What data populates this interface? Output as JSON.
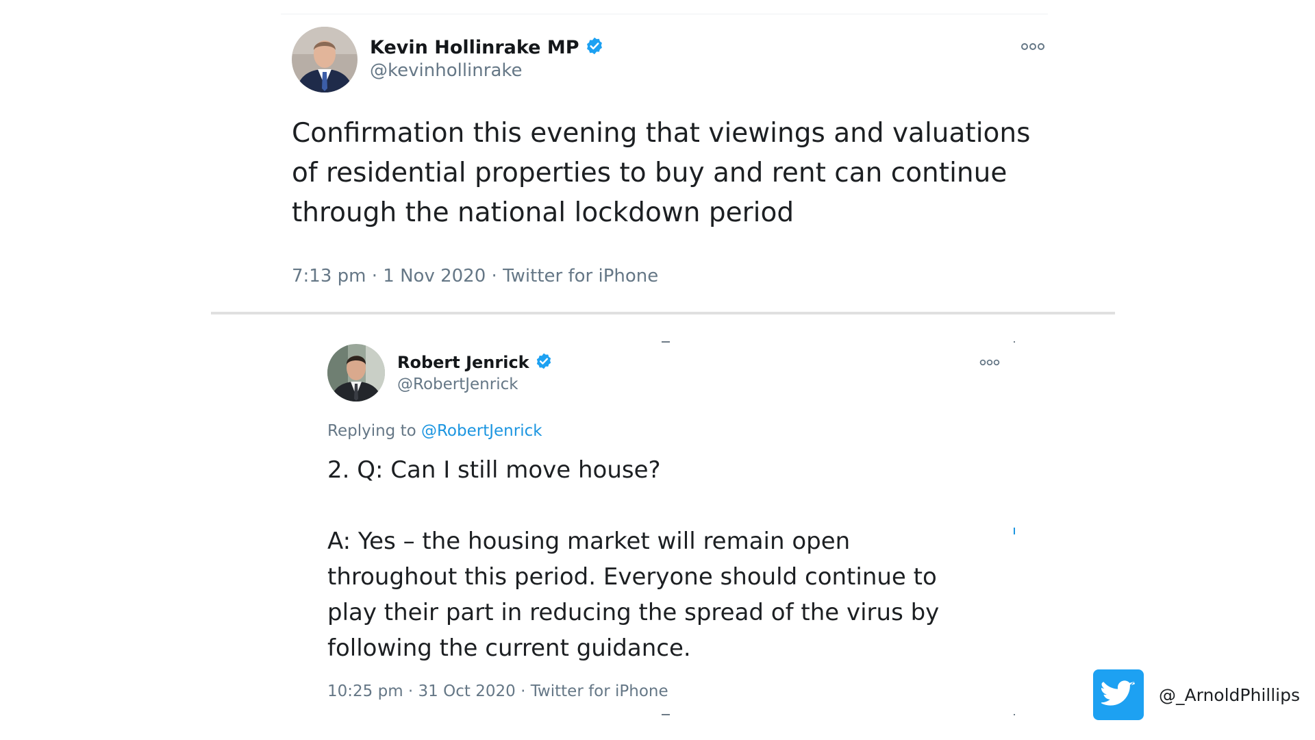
{
  "tweet1": {
    "display_name": "Kevin Hollinrake MP",
    "handle": "@kevinhollinrake",
    "text": "Confirmation this evening that viewings and valuations of residential properties to buy and rent can continue through the national lockdown period",
    "time": "7:13 pm",
    "date": "1 Nov 2020",
    "source": "Twitter for iPhone",
    "verified": true
  },
  "tweet2": {
    "display_name": "Robert Jenrick",
    "handle": "@RobertJenrick",
    "replying_to_prefix": "Replying to",
    "replying_to_handle": "@RobertJenrick",
    "text_question": "2. Q: Can I still move house?",
    "text_answer": "A: Yes – the housing market will remain open throughout this period. Everyone should continue to play their part in reducing the spread of the virus by following the current guidance.",
    "time": "10:25 pm",
    "date": "31 Oct 2020",
    "source": "Twitter for iPhone",
    "verified": true
  },
  "credit": {
    "handle": "@_ArnoldPhillips",
    "icon": "twitter-bird-icon"
  },
  "colors": {
    "twitter_blue": "#1da1f2",
    "link_blue": "#1b95e0",
    "muted_text": "#657786",
    "divider": "#e0e0e0"
  },
  "meta_separator": "·"
}
